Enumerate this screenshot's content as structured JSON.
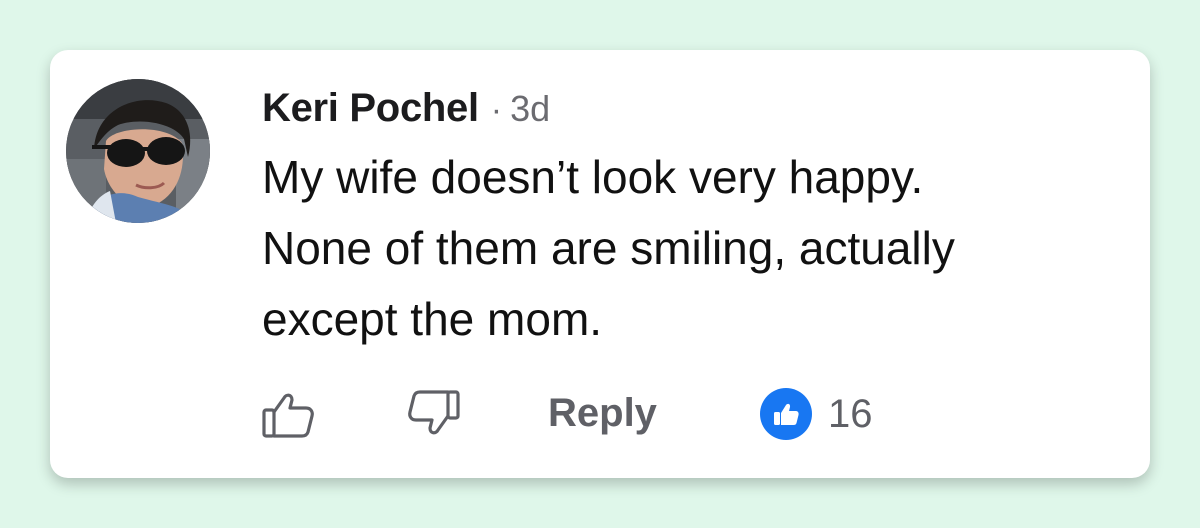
{
  "comment": {
    "author": "Keri Pochel",
    "separator": "·",
    "timestamp": "3d",
    "text_lines": [
      "My wife doesn’t look very happy.",
      "None of them are smiling, actually",
      "except the mom."
    ]
  },
  "actions": {
    "like_icon": "thumbs-up-outline-icon",
    "dislike_icon": "thumbs-down-outline-icon",
    "reply_label": "Reply",
    "reaction_icon": "thumbs-up-filled-icon",
    "reaction_count": "16"
  },
  "colors": {
    "page_background": "#dff7ea",
    "card_background": "#ffffff",
    "reaction_blue": "#1877f2",
    "secondary_text": "#5f6066"
  }
}
